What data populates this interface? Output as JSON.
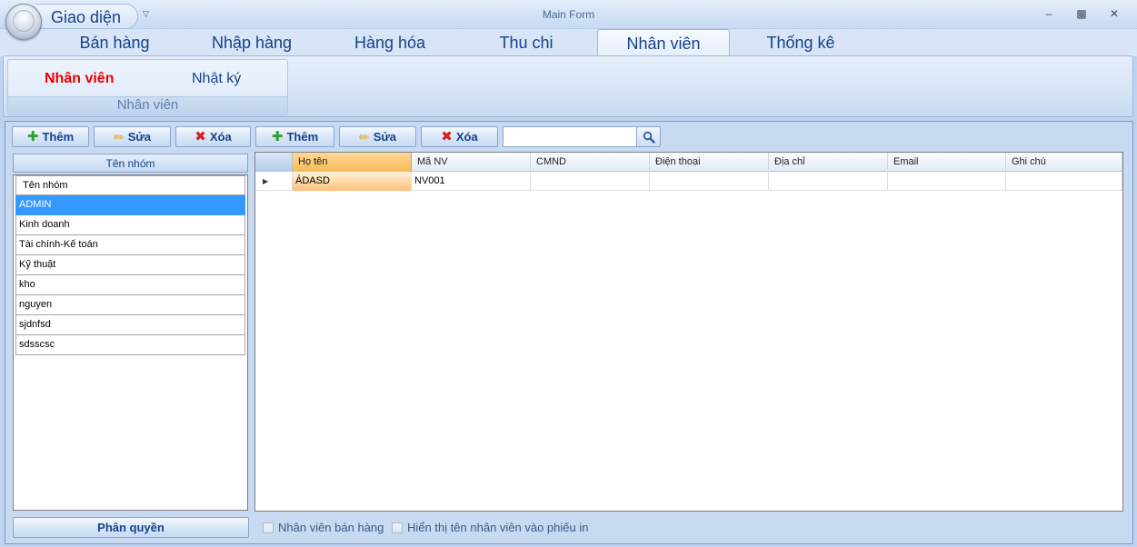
{
  "title_bar": {
    "app_menu_label": "Giao diện",
    "window_title": "Main Form"
  },
  "tabs": [
    {
      "label": "Bán hàng"
    },
    {
      "label": "Nhập hàng"
    },
    {
      "label": "Hàng hóa"
    },
    {
      "label": "Thu chi"
    },
    {
      "label": "Nhân viên",
      "active": true
    },
    {
      "label": "Thống kê"
    }
  ],
  "ribbon": {
    "group_label": "Nhân viên",
    "items": [
      "Nhân viên",
      "Nhật ký"
    ]
  },
  "toolbar": {
    "group_add_label": "Thêm",
    "group_edit_label": "Sửa",
    "group_delete_label": "Xóa",
    "employee_add_label": "Thêm",
    "employee_edit_label": "Sửa",
    "employee_delete_label": "Xóa",
    "search_value": ""
  },
  "group_panel": {
    "header": "Tên nhóm",
    "items": [
      {
        "label": "Tên nhóm"
      },
      {
        "label": "ADMIN",
        "selected": true
      },
      {
        "label": "Kinh doanh"
      },
      {
        "label": "Tài chính-Kế toán"
      },
      {
        "label": "Kỹ thuật"
      },
      {
        "label": "kho"
      },
      {
        "label": "nguyen"
      },
      {
        "label": "sjdnfsd"
      },
      {
        "label": "sdsscsc"
      }
    ],
    "permission_button": "Phân quyền"
  },
  "grid": {
    "columns": [
      "Họ tên",
      "Mã NV",
      "CMND",
      "Điện thoại",
      "Địa chỉ",
      "Email",
      "Ghi chú"
    ],
    "rows": [
      [
        "ÁDASD",
        "NV001",
        "",
        "",
        "",
        "",
        ""
      ]
    ]
  },
  "options": {
    "sales_staff_label": "Nhân viên bán hàng",
    "show_name_label": "Hiển thị tên nhân viên vào phiếu in"
  },
  "colors": {
    "accent": "#15428b",
    "selected_row": "#3399ff",
    "active_cell": "#f7b955",
    "active_ribbon_item": "#ee0000"
  }
}
